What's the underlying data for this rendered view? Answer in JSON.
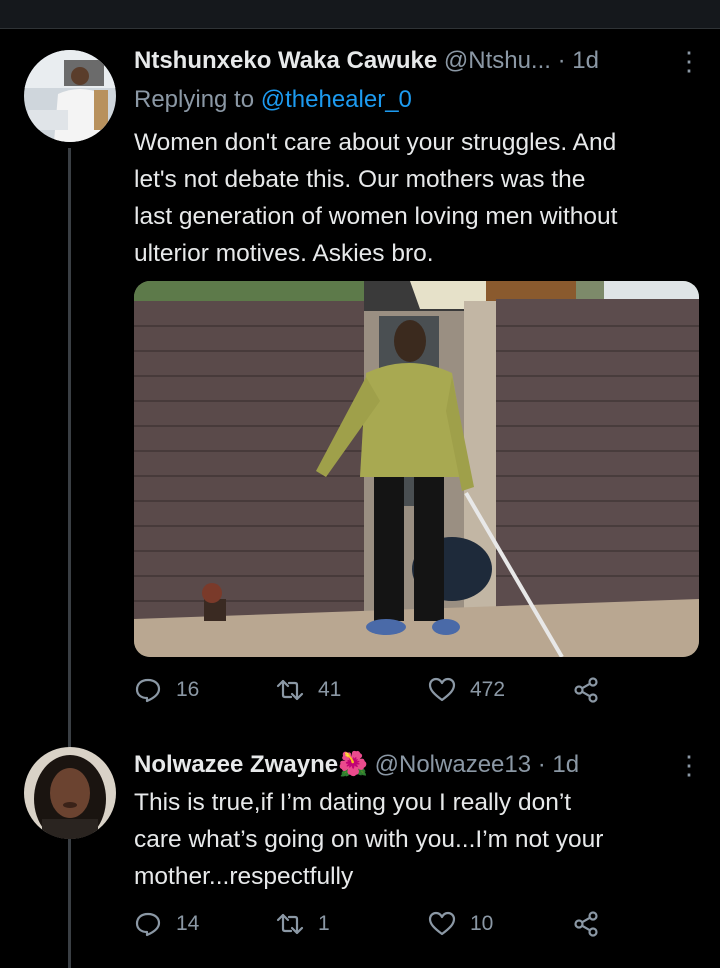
{
  "tweets": [
    {
      "name": "Ntshunxeko Waka Cawuke",
      "handle": "@Ntshu...",
      "time": "· 1d",
      "reply_prefix": "Replying to ",
      "reply_to": "@thehealer_0",
      "lines": [
        "Women don't care about your struggles. And",
        "let's not debate this. Our mothers was the",
        "last generation of women loving men without",
        "ulterior motives. Askies bro."
      ],
      "stats": {
        "replies": "16",
        "retweets": "41",
        "likes": "472"
      }
    },
    {
      "name": "Nolwazee Zwayne",
      "emoji": "🌺",
      "handle": "@Nolwazee13",
      "time": "· 1d",
      "lines": [
        "This is true,if I’m dating you I really don’t",
        "care what’s going on with you...I’m not your",
        "mother...respectfully"
      ],
      "stats": {
        "replies": "14",
        "retweets": "1",
        "likes": "10"
      }
    }
  ],
  "icons": {
    "reply": "reply-icon",
    "retweet": "retweet-icon",
    "like": "heart-icon",
    "share": "share-icon",
    "more": "more-vertical-icon"
  },
  "colors": {
    "background": "#000000",
    "text": "#e7e9ea",
    "muted": "#8b98a5",
    "link": "#1d9bf0"
  }
}
